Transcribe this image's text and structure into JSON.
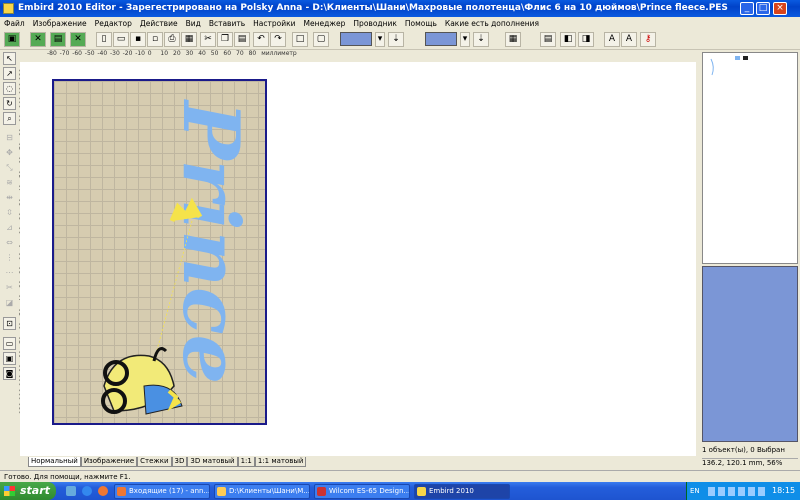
{
  "window": {
    "title": "Embird 2010 Editor - Зарегестрировано на Polsky Anna - D:\\Клиенты\\Шани\\Махровые полотенца\\Флис 6 на 10 дюймов\\Prince fleece.PES"
  },
  "menu": [
    "Файл",
    "Изображение",
    "Редактор",
    "Действие",
    "Вид",
    "Вставить",
    "Настройки",
    "Менеджер",
    "Проводник",
    "Помощь",
    "Какие есть дополнения"
  ],
  "ruler_top": {
    "ticks": [
      "-80",
      "-70",
      "-60",
      "-50",
      "-40",
      "-30",
      "-20",
      "-10",
      "0",
      "10",
      "20",
      "30",
      "40",
      "50",
      "60",
      "70",
      "80"
    ],
    "unit": "миллиметр"
  },
  "ruler_left": {
    "ticks": [
      "120",
      "110",
      "100",
      "90",
      "80",
      "70",
      "60",
      "50",
      "40",
      "30",
      "20",
      "10",
      "0",
      "-10",
      "-20",
      "-30",
      "-40",
      "-50",
      "-60",
      "-70",
      "-80",
      "-90",
      "-100",
      "-110",
      "-120"
    ]
  },
  "design": {
    "text": "Prince",
    "colors": {
      "text": "#7fb4f0",
      "crown": "#f5e34a",
      "carriage_body": "#f2ea78",
      "carriage_hood": "#4a90e2",
      "wheels": "#111111"
    }
  },
  "view_tabs": [
    "Нормальный",
    "Изображение",
    "Стежки",
    "3D",
    "3D матовый",
    "1:1",
    "1:1 матовый"
  ],
  "status": {
    "help": "Готово. Для помощи, нажмите F1.",
    "objects": "1 объект(ы), 0 Выбран",
    "coords": "136.2, 120.1 mm, 56%"
  },
  "toolbar_labels": {
    "insert_text": "A",
    "wrap_text": "A"
  },
  "taskbar": {
    "start": "start",
    "tasks": [
      "Входящие (17) - ann...",
      "D:\\Клиенты\\Шани\\М...",
      "Wilcom ES-65 Design...",
      "Embird 2010"
    ],
    "lang": "EN",
    "clock": "18:15"
  }
}
